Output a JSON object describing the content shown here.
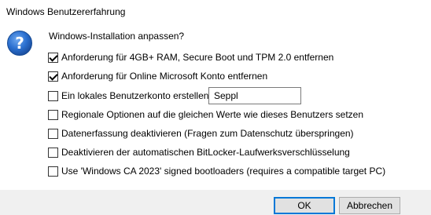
{
  "window": {
    "title": "Windows Benutzererfahrung"
  },
  "dialog": {
    "icon": "question-icon",
    "heading": "Windows-Installation anpassen?",
    "options": [
      {
        "label": "Anforderung für 4GB+ RAM, Secure Boot und TPM 2.0 entfernen",
        "checked": true
      },
      {
        "label": "Anforderung für Online Microsoft Konto entfernen",
        "checked": true
      },
      {
        "label": "Ein lokales Benutzerkonto erstellen:",
        "checked": false
      },
      {
        "label": "Regionale Optionen auf die gleichen Werte wie dieses Benutzers setzen",
        "checked": false
      },
      {
        "label": "Datenerfassung deaktivieren (Fragen zum Datenschutz überspringen)",
        "checked": false
      },
      {
        "label": "Deaktivieren der automatischen BitLocker-Laufwerksverschlüsselung",
        "checked": false
      },
      {
        "label": "Use 'Windows CA 2023' signed bootloaders (requires a compatible target PC)",
        "checked": false
      }
    ],
    "username_value": "Seppl"
  },
  "buttons": {
    "ok": "OK",
    "cancel": "Abbrechen"
  },
  "colors": {
    "accent": "#0078d7",
    "footer": "#f0f0f0",
    "icon_blue": "#1c5fb4"
  }
}
